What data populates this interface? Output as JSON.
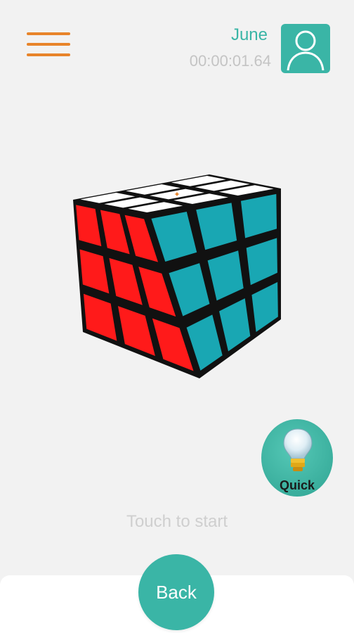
{
  "header": {
    "menu_icon": "hamburger-icon",
    "user_name": "June",
    "timer": "00:00:01.64",
    "avatar_icon": "user-avatar-icon"
  },
  "cube": {
    "top_color": "#ffffff",
    "front_color": "#ff1a1a",
    "right_color": "#19a7b3",
    "border_color": "#111111",
    "center_logo_icon": "logo-icon"
  },
  "quick": {
    "label": "Quick",
    "icon": "lightbulb-icon"
  },
  "hint": "Touch to start",
  "back_label": "Back",
  "colors": {
    "accent": "#3ab5a6",
    "menu": "#e8842a",
    "background": "#f2f2f2"
  }
}
